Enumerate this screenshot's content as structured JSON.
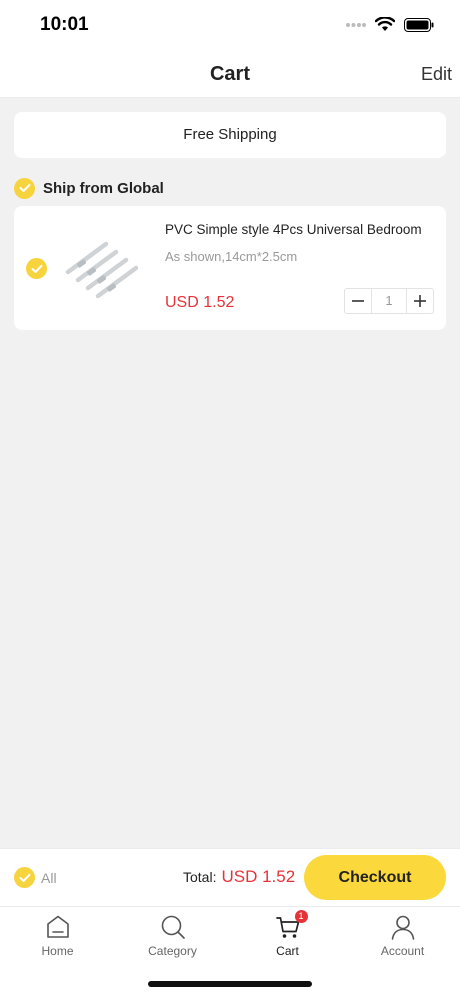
{
  "status_bar": {
    "time": "10:01"
  },
  "header": {
    "title": "Cart",
    "edit_label": "Edit"
  },
  "shipping_banner": {
    "text": "Free Shipping"
  },
  "cart_group": {
    "title": "Ship from Global",
    "items": [
      {
        "title": "PVC Simple style 4Pcs Universal Bedroom",
        "variant": "As shown,14cm*2.5cm",
        "price": "USD 1.52",
        "quantity": "1"
      }
    ]
  },
  "checkout_bar": {
    "all_label": "All",
    "total_label": "Total:",
    "total_value": "USD 1.52",
    "checkout_label": "Checkout"
  },
  "tabbar": {
    "tabs": [
      {
        "label": "Home",
        "icon": "home-icon"
      },
      {
        "label": "Category",
        "icon": "search-icon"
      },
      {
        "label": "Cart",
        "icon": "cart-icon",
        "badge": "1",
        "active": true
      },
      {
        "label": "Account",
        "icon": "person-icon"
      }
    ]
  },
  "colors": {
    "accent": "#fbd83c",
    "price": "#e5333a",
    "background": "#f1f1f1"
  }
}
